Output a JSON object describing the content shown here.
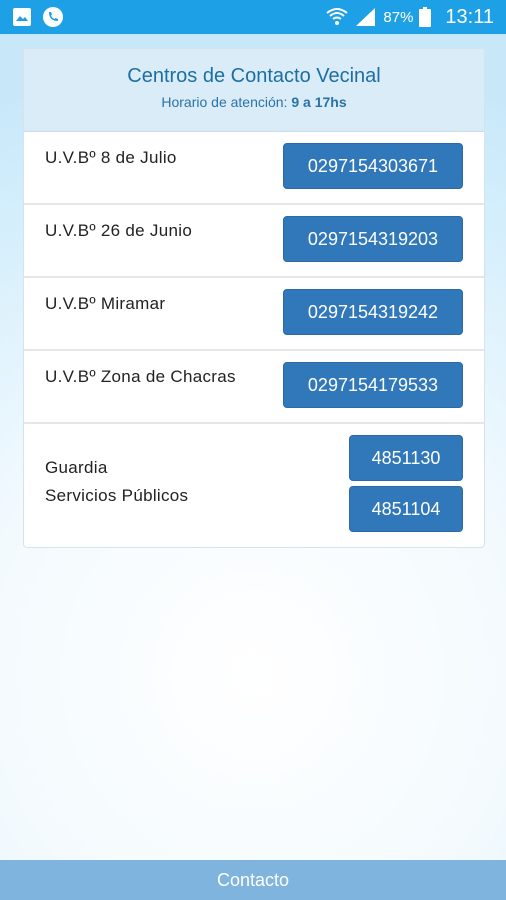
{
  "statusbar": {
    "battery_pct": "87%",
    "time": "13:11",
    "icons": [
      "gallery-notification-icon",
      "phone-notification-icon",
      "wifi-icon",
      "signal-icon",
      "battery-icon"
    ]
  },
  "card": {
    "title": "Centros de Contacto Vecinal",
    "subtitle_prefix": "Horario de atención: ",
    "subtitle_hours": "9 a 17hs",
    "rows": [
      {
        "label": "U.V.Bº 8 de Julio",
        "phone": "0297154303671"
      },
      {
        "label": "U.V.Bº 26 de Junio",
        "phone": "0297154319203"
      },
      {
        "label": "U.V.Bº Miramar",
        "phone": "0297154319242"
      },
      {
        "label": "U.V.Bº Zona de Chacras",
        "phone": "0297154179533"
      }
    ],
    "last_row": {
      "label_line1": "Guardia",
      "label_line2": "Servicios Públicos",
      "phone1": "4851130",
      "phone2": "4851104"
    }
  },
  "bottombar": {
    "label": "Contacto"
  },
  "colors": {
    "statusbar": "#1ea0e6",
    "button": "#3078b9",
    "header_bg": "#d9ecf8",
    "bottombar": "#7fb4df"
  }
}
